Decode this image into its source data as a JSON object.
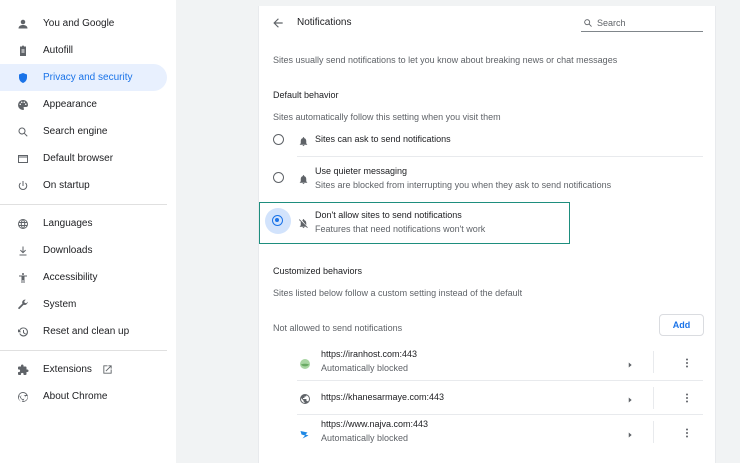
{
  "sidebar": {
    "items": [
      {
        "label": "You and Google",
        "icon": "person-icon"
      },
      {
        "label": "Autofill",
        "icon": "clipboard-icon"
      },
      {
        "label": "Privacy and security",
        "icon": "shield-icon",
        "active": true
      },
      {
        "label": "Appearance",
        "icon": "palette-icon"
      },
      {
        "label": "Search engine",
        "icon": "search-icon"
      },
      {
        "label": "Default browser",
        "icon": "browser-icon"
      },
      {
        "label": "On startup",
        "icon": "power-icon"
      },
      {
        "label": "Languages",
        "icon": "globe-icon"
      },
      {
        "label": "Downloads",
        "icon": "download-icon"
      },
      {
        "label": "Accessibility",
        "icon": "accessibility-icon"
      },
      {
        "label": "System",
        "icon": "wrench-icon"
      },
      {
        "label": "Reset and clean up",
        "icon": "reset-icon"
      },
      {
        "label": "Extensions",
        "icon": "puzzle-icon"
      },
      {
        "label": "About Chrome",
        "icon": "chrome-icon"
      }
    ]
  },
  "header": {
    "title": "Notifications",
    "search_placeholder": "Search"
  },
  "main": {
    "intro": "Sites usually send notifications to let you know about breaking news or chat messages",
    "default_behavior": {
      "heading": "Default behavior",
      "subtitle": "Sites automatically follow this setting when you visit them",
      "options": [
        {
          "title": "Sites can ask to send notifications",
          "subtitle": "",
          "selected": false
        },
        {
          "title": "Use quieter messaging",
          "subtitle": "Sites are blocked from interrupting you when they ask to send notifications",
          "selected": false
        },
        {
          "title": "Don't allow sites to send notifications",
          "subtitle": "Features that need notifications won't work",
          "selected": true
        }
      ]
    },
    "customized": {
      "heading": "Customized behaviors",
      "subtitle": "Sites listed below follow a custom setting instead of the default",
      "not_allowed_label": "Not allowed to send notifications",
      "add_label": "Add",
      "sites": [
        {
          "url": "https://iranhost.com:443",
          "status": "Automatically blocked"
        },
        {
          "url": "https://khanesarmaye.com:443",
          "status": ""
        },
        {
          "url": "https://www.najva.com:443",
          "status": "Automatically blocked"
        }
      ]
    }
  },
  "colors": {
    "accent": "#1a73e8",
    "active_bg": "#e8f0fe",
    "focus_ring": "#1e8e7e"
  }
}
